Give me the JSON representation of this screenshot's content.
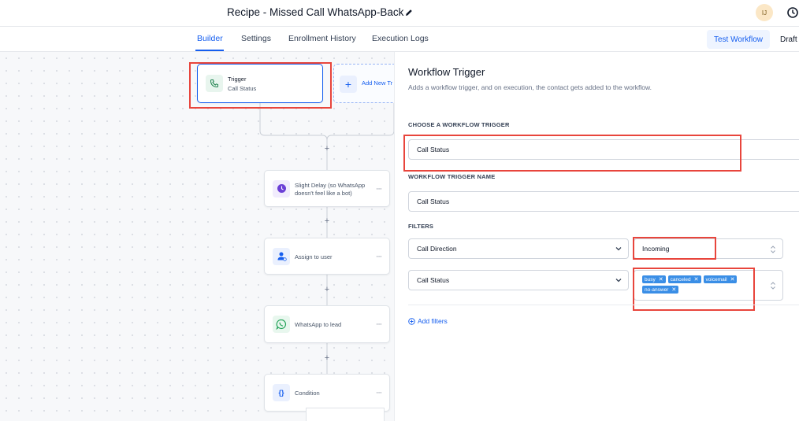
{
  "header": {
    "title": "Recipe - Missed Call WhatsApp-Back",
    "avatar_initials": "IJ"
  },
  "tabs": [
    {
      "label": "Builder",
      "active": true
    },
    {
      "label": "Settings"
    },
    {
      "label": "Enrollment History"
    },
    {
      "label": "Execution Logs"
    }
  ],
  "actions": {
    "test_workflow": "Test Workflow",
    "status": "Draft"
  },
  "canvas": {
    "trigger": {
      "title": "Trigger",
      "subtitle": "Call Status",
      "icon": "phone-icon"
    },
    "add_trigger": "Add New Tr",
    "steps": [
      {
        "label": "Slight Delay (so WhatsApp doesn't feel like a bot)",
        "icon": "clock-icon"
      },
      {
        "label": "Assign to user",
        "icon": "user-icon"
      },
      {
        "label": "WhatsApp to lead",
        "icon": "whatsapp-icon"
      },
      {
        "label": "Condition",
        "icon": "braces-icon"
      }
    ],
    "more": "···",
    "plus": "+"
  },
  "panel": {
    "title": "Workflow Trigger",
    "subtitle": "Adds a workflow trigger, and on execution, the contact gets added to the workflow.",
    "choose_label": "CHOOSE A WORKFLOW TRIGGER",
    "choose_value": "Call Status",
    "name_label": "WORKFLOW TRIGGER NAME",
    "name_value": "Call Status",
    "filters_label": "FILTERS",
    "filters": [
      {
        "field": "Call Direction",
        "value": "Incoming"
      },
      {
        "field": "Call Status",
        "tags": [
          "busy",
          "canceled",
          "voicemail",
          "no-answer"
        ]
      }
    ],
    "add_filters": "Add filters"
  },
  "colors": {
    "accent": "#155eef",
    "annotation": "#e8453c",
    "tag": "#3a8ee6"
  }
}
